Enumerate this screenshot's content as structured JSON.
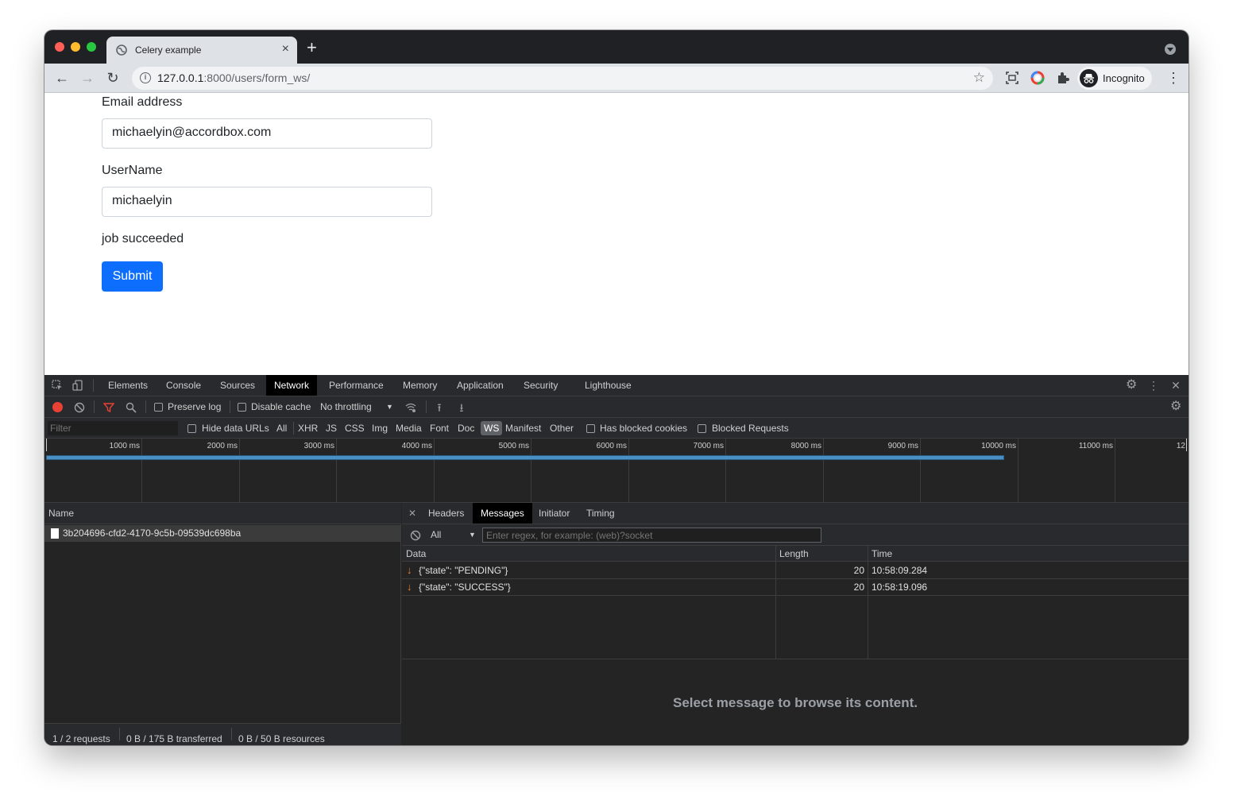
{
  "browser": {
    "tab_title": "Celery example",
    "url_host": "127.0.0.1",
    "url_rest": ":8000/users/form_ws/",
    "profile_label": "Incognito"
  },
  "page": {
    "email_label": "Email address",
    "email_value": "michaelyin@accordbox.com",
    "username_label": "UserName",
    "username_value": "michaelyin",
    "status_text": "job succeeded",
    "submit_label": "Submit"
  },
  "devtools": {
    "tabs": [
      "Elements",
      "Console",
      "Sources",
      "Network",
      "Performance",
      "Memory",
      "Application",
      "Security",
      "Lighthouse"
    ],
    "active_tab": "Network",
    "toolbar": {
      "preserve_log": "Preserve log",
      "disable_cache": "Disable cache",
      "throttling": "No throttling"
    },
    "filter_bar": {
      "filter_placeholder": "Filter",
      "hide_data_urls": "Hide data URLs",
      "types": [
        "All",
        "XHR",
        "JS",
        "CSS",
        "Img",
        "Media",
        "Font",
        "Doc",
        "WS",
        "Manifest",
        "Other"
      ],
      "active_type": "WS",
      "has_blocked_cookies": "Has blocked cookies",
      "blocked_requests": "Blocked Requests"
    },
    "timeline_ticks": [
      "1000 ms",
      "2000 ms",
      "3000 ms",
      "4000 ms",
      "5000 ms",
      "6000 ms",
      "7000 ms",
      "8000 ms",
      "9000 ms",
      "10000 ms",
      "11000 ms",
      "12"
    ],
    "requests": {
      "column": "Name",
      "rows": [
        "3b204696-cfd2-4170-9c5b-09539dc698ba"
      ]
    },
    "status": {
      "requests": "1 / 2 requests",
      "transferred": "0 B / 175 B transferred",
      "resources": "0 B / 50 B resources"
    },
    "detail": {
      "tabs": [
        "Headers",
        "Messages",
        "Initiator",
        "Timing"
      ],
      "active_tab": "Messages",
      "filter_select": "All",
      "regex_placeholder": "Enter regex, for example: (web)?socket",
      "columns": [
        "Data",
        "Length",
        "Time"
      ],
      "messages": [
        {
          "data": "{\"state\": \"PENDING\"}",
          "length": "20",
          "time": "10:58:09.284"
        },
        {
          "data": "{\"state\": \"SUCCESS\"}",
          "length": "20",
          "time": "10:58:19.096"
        }
      ],
      "empty_text": "Select message to browse its content."
    }
  }
}
